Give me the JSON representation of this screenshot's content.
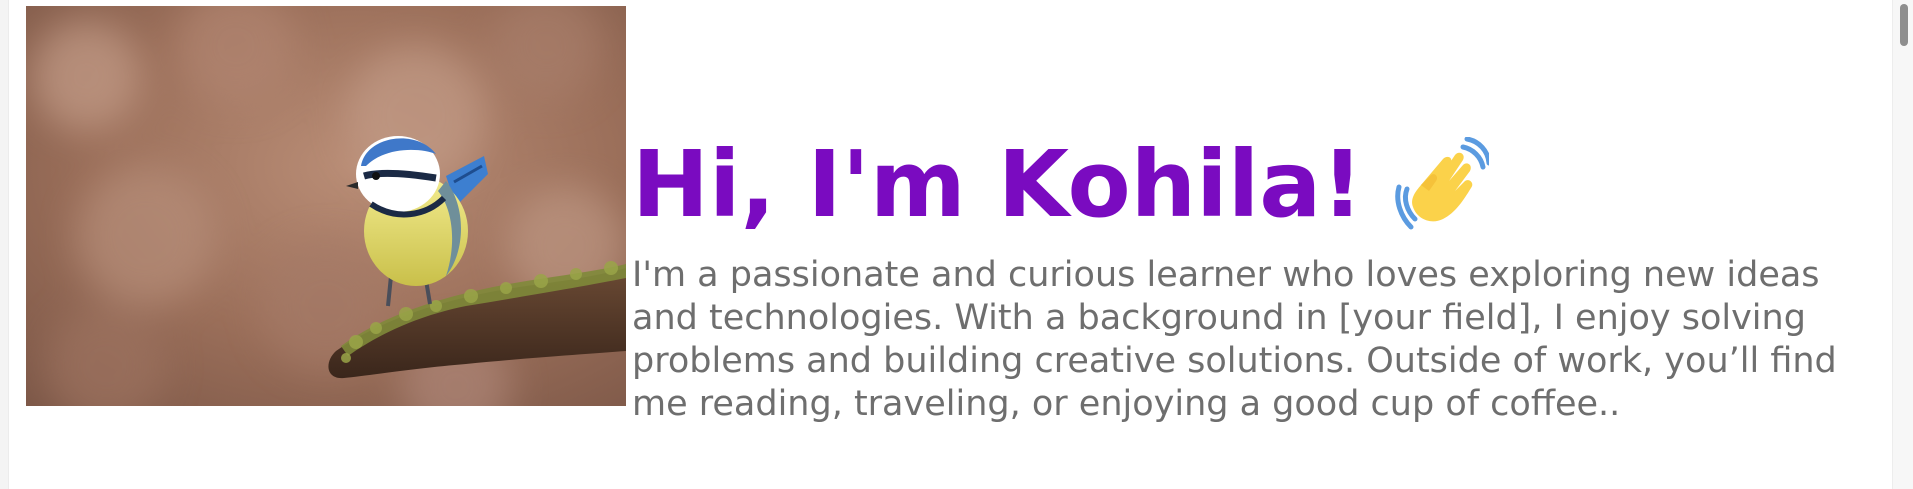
{
  "hero": {
    "title": "Hi, I'm Kohila!",
    "bio": "I'm a passionate and curious learner who loves exploring new ideas and technologies. With a background in [your field], I enjoy solving problems and building creative solutions. Outside of work, you’ll find me reading, traveling, or enjoying a good cup of coffee..",
    "wave_icon": "waving-hand-icon",
    "image_subject": "blue tit bird perched on mossy branch"
  },
  "colors": {
    "title": "#7a0bc0",
    "bio": "#6e6e6e",
    "background": "#ffffff"
  }
}
